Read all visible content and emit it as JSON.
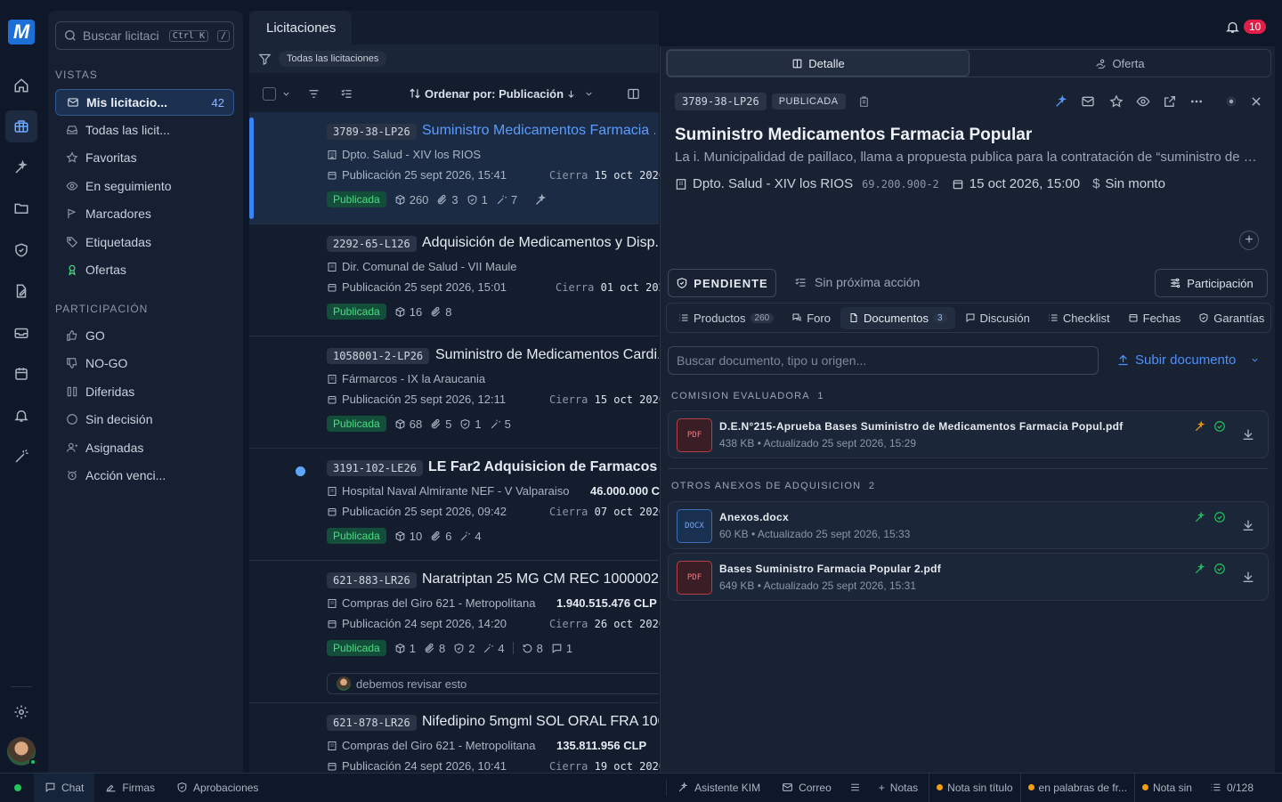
{
  "rail": {
    "logo": "M",
    "items": [
      "home-icon",
      "briefcase-icon",
      "sparkle-wand-icon",
      "folder-icon",
      "shield-icon",
      "document-edit-icon",
      "inbox-icon",
      "calendar-icon",
      "bell-icon",
      "magic-wand-icon"
    ],
    "settings": "gear-icon"
  },
  "sidebar": {
    "search_placeholder": "Buscar licitaci",
    "kbd1": "Ctrl K",
    "kbd2": "/",
    "views_title": "VISTAS",
    "views": [
      {
        "label": "Mis licitacio...",
        "count": "42",
        "icon": "inbox-icon"
      },
      {
        "label": "Todas las licit...",
        "icon": "tray-icon"
      },
      {
        "label": "Favoritas",
        "icon": "star-icon"
      },
      {
        "label": "En seguimiento",
        "icon": "eye-icon"
      },
      {
        "label": "Marcadores",
        "icon": "flag-icon"
      },
      {
        "label": "Etiquetadas",
        "icon": "tag-icon"
      },
      {
        "label": "Ofertas",
        "icon": "award-icon"
      }
    ],
    "part_title": "PARTICIPACIÓN",
    "participation": [
      {
        "label": "GO",
        "icon": "thumbs-up-icon"
      },
      {
        "label": "NO-GO",
        "icon": "thumbs-down-icon"
      },
      {
        "label": "Diferidas",
        "icon": "columns-icon"
      },
      {
        "label": "Sin decisión",
        "icon": "circle-icon"
      },
      {
        "label": "Asignadas",
        "icon": "user-icon"
      },
      {
        "label": "Acción venci...",
        "icon": "alarm-icon"
      }
    ]
  },
  "list": {
    "tab": "Licitaciones",
    "filter_chip": "Todas las licitaciones",
    "sort_label": "Ordenar por: Publicación",
    "cards": [
      {
        "code": "3789-38-LP26",
        "title": "Suministro Medicamentos Farmacia ...",
        "org": "Dpto. Salud - XIV los RIOS",
        "amount": "",
        "pub": "Publicación 25 sept 2026, 15:41",
        "cierra": "Cierra",
        "cierra_date": "15 oct 2026",
        "status": "Publicada",
        "b1": "260",
        "b2": "3",
        "b3": "1",
        "b4": "7"
      },
      {
        "code": "2292-65-L126",
        "title": "Adquisición de Medicamentos y Disp...",
        "org": "Dir. Comunal de Salud - VII Maule",
        "amount": "",
        "pub": "Publicación 25 sept 2026, 15:01",
        "cierra": "Cierra",
        "cierra_date": "01 oct 202",
        "status": "Publicada",
        "b1": "16",
        "b2": "8"
      },
      {
        "code": "1058001-2-LP26",
        "title": "Suministro de Medicamentos Cardi...",
        "org": "Fármarcos - IX la Araucania",
        "amount": "",
        "pub": "Publicación 25 sept 2026, 12:11",
        "cierra": "Cierra",
        "cierra_date": "15 oct 2026",
        "status": "Publicada",
        "b1": "68",
        "b2": "5",
        "b3": "1",
        "b4": "5"
      },
      {
        "code": "3191-102-LE26",
        "title": "LE Far2 Adquisicion de Farmacos",
        "org": "Hospital Naval Almirante NEF - V Valparaiso",
        "amount": "46.000.000 C",
        "pub": "Publicación 25 sept 2026, 09:42",
        "cierra": "Cierra",
        "cierra_date": "07 oct 2026",
        "status": "Publicada",
        "b1": "10",
        "b2": "6",
        "b4": "4"
      },
      {
        "code": "621-883-LR26",
        "title": "Naratriptan 25 MG CM REC 1000002...",
        "org": "Compras del Giro 621 - Metropolitana",
        "amount": "1.940.515.476 CLP",
        "pub": "Publicación 24 sept 2026, 14:20",
        "cierra": "Cierra",
        "cierra_date": "26 oct 2026",
        "status": "Publicada",
        "b1": "1",
        "b2": "8",
        "b3": "2",
        "b4": "4",
        "b5": "8",
        "b6": "1",
        "note": "debemos revisar esto"
      },
      {
        "code": "621-878-LR26",
        "title": "Nifedipino 5mgml SOL ORAL FRA 100...",
        "org": "Compras del Giro 621 - Metropolitana",
        "amount": "135.811.956 CLP",
        "pub": "Publicación 24 sept 2026, 10:41",
        "cierra": "Cierra",
        "cierra_date": "19 oct 2026"
      }
    ]
  },
  "detail": {
    "tab_detalle": "Detalle",
    "tab_oferta": "Oferta",
    "code": "3789-38-LP26",
    "state": "PUBLICADA",
    "title": "Suministro Medicamentos Farmacia Popular",
    "desc": "La i. Municipalidad de paillaco, llama a propuesta publica para la contratación de “suministro de medicamentos farmacia popular”",
    "org": "Dpto. Salud - XIV los RIOS",
    "rut": "69.200.900-2",
    "date": "15 oct 2026, 15:00",
    "amount": "Sin monto",
    "pending": "PENDIENTE",
    "next_action": "Sin próxima acción",
    "participation": "Participación",
    "subtabs": [
      {
        "label": "Productos",
        "badge": "260"
      },
      {
        "label": "Foro"
      },
      {
        "label": "Documentos",
        "badge": "3"
      },
      {
        "label": "Discusión"
      },
      {
        "label": "Checklist"
      },
      {
        "label": "Fechas"
      },
      {
        "label": "Garantías"
      }
    ],
    "doc_search_placeholder": "Buscar documento, tipo u origen...",
    "upload": "Subir documento",
    "groups": [
      {
        "title": "COMISION EVALUADORA",
        "count": "1",
        "docs": [
          {
            "type": "PDF",
            "name": "D.E.N°215-Aprueba Bases Suministro de Medicamentos Farmacia Popul.pdf",
            "meta": "438  KB • Actualizado 25 sept 2026, 15:29"
          }
        ]
      },
      {
        "title": "OTROS ANEXOS DE ADQUISICION",
        "count": "2",
        "docs": [
          {
            "type": "DOCX",
            "name": "Anexos.docx",
            "meta": "60  KB • Actualizado 25 sept 2026, 15:33"
          },
          {
            "type": "PDF",
            "name": "Bases Suministro Farmacia Popular 2.pdf",
            "meta": "649  KB • Actualizado 25 sept 2026, 15:31"
          }
        ]
      }
    ]
  },
  "topbar": {
    "notifications": "10"
  },
  "bottom": {
    "chat": "Chat",
    "firmas": "Firmas",
    "aprobaciones": "Aprobaciones",
    "asistente": "Asistente KIM",
    "correo": "Correo",
    "notas": "Notas",
    "note1": "Nota sin título",
    "note2": "en palabras de fr...",
    "note3": "Nota sin",
    "counter": "0/128"
  },
  "colors": {
    "accent": "#3b82f6",
    "success": "#4ade80",
    "danger": "#e11d48",
    "warning": "#f59e0b"
  }
}
